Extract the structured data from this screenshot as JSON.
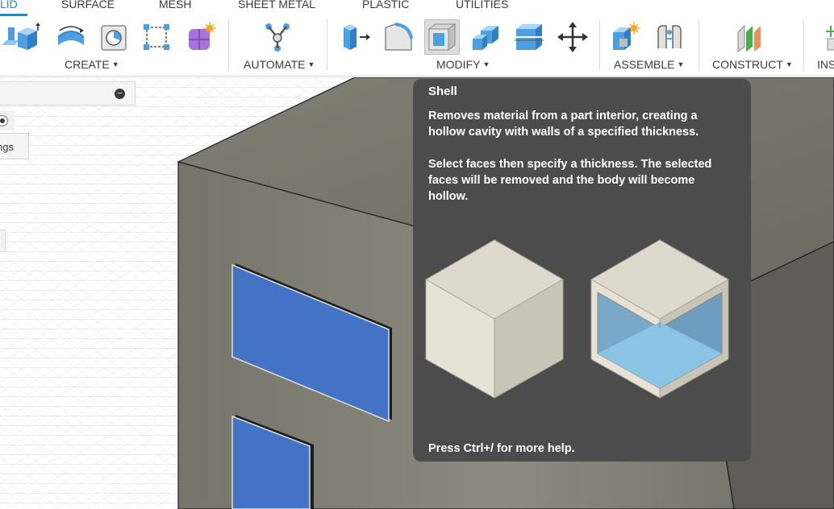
{
  "tabs": [
    {
      "label": "LID",
      "active": true
    },
    {
      "label": "SURFACE",
      "active": false
    },
    {
      "label": "MESH",
      "active": false
    },
    {
      "label": "SHEET METAL",
      "active": false
    },
    {
      "label": "PLASTIC",
      "active": false
    },
    {
      "label": "UTILITIES",
      "active": false
    }
  ],
  "toolbar": {
    "groups": [
      {
        "label": "CREATE",
        "tools": [
          "extrude-icon",
          "revolve-icon",
          "hole-icon",
          "sketch-icon",
          "form-icon"
        ]
      },
      {
        "label": "AUTOMATE",
        "tools": [
          "automate-icon"
        ]
      },
      {
        "label": "MODIFY",
        "tools": [
          "press-pull-icon",
          "fillet-icon",
          "shell-icon",
          "combine-icon",
          "offset-face-icon",
          "move-icon"
        ],
        "highlighted": "shell-icon"
      },
      {
        "label": "ASSEMBLE",
        "tools": [
          "new-component-icon",
          "joint-icon"
        ]
      },
      {
        "label": "CONSTRUCT",
        "tools": [
          "offset-plane-icon"
        ]
      },
      {
        "label": "INS",
        "tools": [
          "insert-icon"
        ]
      }
    ]
  },
  "browser": {
    "collapse_symbol": "−",
    "item_label": "ngs"
  },
  "tooltip": {
    "title": "Shell",
    "description": "Removes material from a part interior, creating a hollow cavity with walls of a specified thickness.",
    "instructions": "Select faces then specify a thickness. The selected faces will be removed and the body will become hollow.",
    "footer": "Press Ctrl+/ for more help."
  },
  "colors": {
    "accent": "#0696d7",
    "tooltip_bg": "#4c4c4c",
    "face_blue": "#4472c4",
    "body_gray": "#7d7d72"
  }
}
